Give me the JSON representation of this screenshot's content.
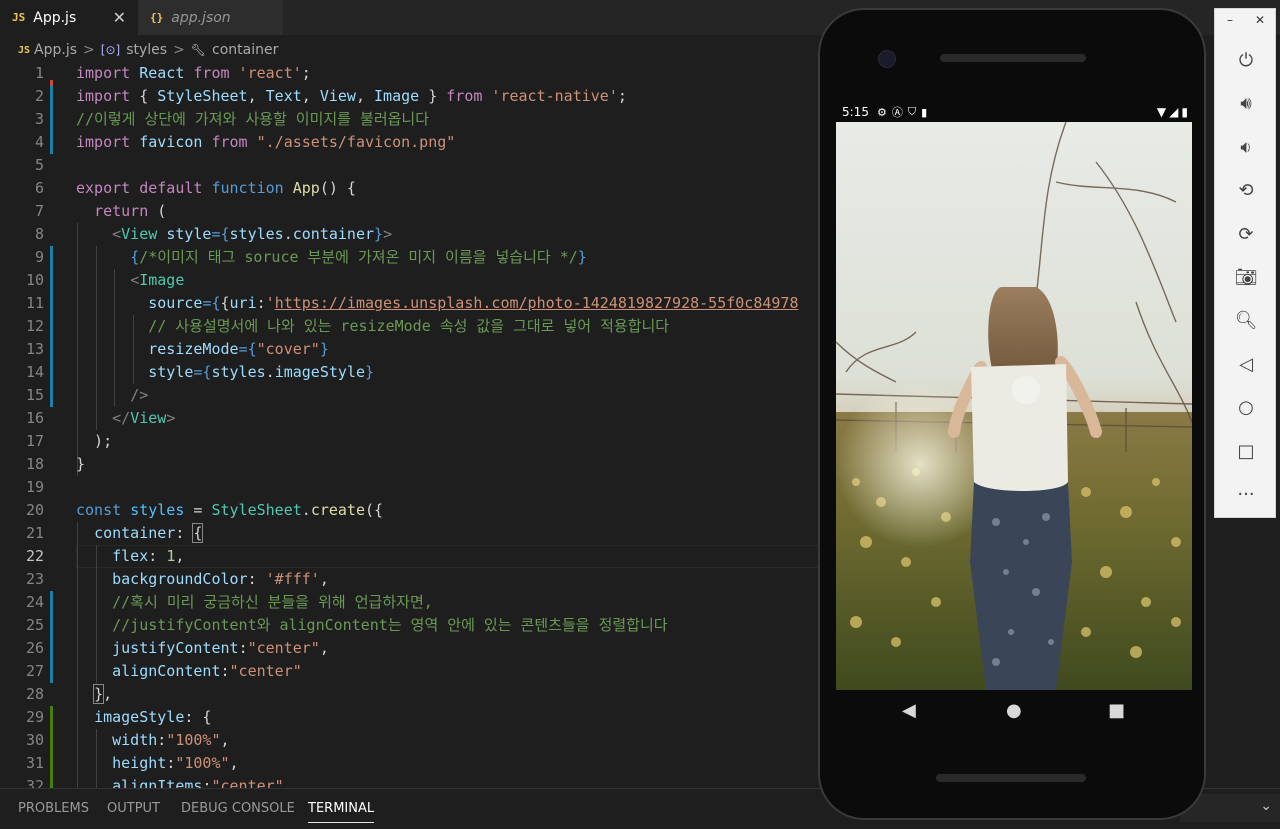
{
  "tabs": [
    {
      "icon": "JS",
      "label": "App.js",
      "close": "✕"
    },
    {
      "icon": "{}",
      "label": "app.json"
    }
  ],
  "breadcrumb": {
    "file_icon": "JS",
    "file": "App.js",
    "sep": ">",
    "b1": "styles",
    "b2": "container"
  },
  "code_lines": [
    [
      {
        "t": "import",
        "c": "#c586c0"
      },
      {
        "t": " React ",
        "c": "#9cdcfe"
      },
      {
        "t": "from",
        "c": "#c586c0"
      },
      {
        "t": " 'react'",
        "c": "#ce9178"
      },
      {
        "t": ";",
        "c": "#d4d4d4"
      }
    ],
    [
      {
        "t": "import",
        "c": "#c586c0"
      },
      {
        "t": " { ",
        "c": "#d4d4d4"
      },
      {
        "t": "StyleSheet",
        "c": "#9cdcfe"
      },
      {
        "t": ", ",
        "c": "#d4d4d4"
      },
      {
        "t": "Text",
        "c": "#9cdcfe"
      },
      {
        "t": ", ",
        "c": "#d4d4d4"
      },
      {
        "t": "View",
        "c": "#9cdcfe"
      },
      {
        "t": ", ",
        "c": "#d4d4d4"
      },
      {
        "t": "Image",
        "c": "#9cdcfe"
      },
      {
        "t": " } ",
        "c": "#d4d4d4"
      },
      {
        "t": "from",
        "c": "#c586c0"
      },
      {
        "t": " 'react-native'",
        "c": "#ce9178"
      },
      {
        "t": ";",
        "c": "#d4d4d4"
      }
    ],
    [
      {
        "t": "//이렇게 상단에 가져와 사용할 이미지를 불러옵니다",
        "c": "#6a9955"
      }
    ],
    [
      {
        "t": "import",
        "c": "#c586c0"
      },
      {
        "t": " favicon ",
        "c": "#9cdcfe"
      },
      {
        "t": "from",
        "c": "#c586c0"
      },
      {
        "t": " \"./assets/favicon.png\"",
        "c": "#ce9178"
      }
    ],
    [],
    [
      {
        "t": "export",
        "c": "#c586c0"
      },
      {
        "t": " ",
        "c": "#d4d4d4"
      },
      {
        "t": "default",
        "c": "#c586c0"
      },
      {
        "t": " ",
        "c": "#d4d4d4"
      },
      {
        "t": "function",
        "c": "#569cd6"
      },
      {
        "t": " ",
        "c": "#d4d4d4"
      },
      {
        "t": "App",
        "c": "#dcdcaa"
      },
      {
        "t": "() {",
        "c": "#d4d4d4"
      }
    ],
    [
      {
        "t": "  ",
        "c": "#d4d4d4"
      },
      {
        "t": "return",
        "c": "#c586c0"
      },
      {
        "t": " (",
        "c": "#d4d4d4"
      }
    ],
    [
      {
        "t": "    ",
        "c": "#d4d4d4"
      },
      {
        "t": "<",
        "c": "#808080"
      },
      {
        "t": "View",
        "c": "#4ec9b0"
      },
      {
        "t": " ",
        "c": "#d4d4d4"
      },
      {
        "t": "style",
        "c": "#9cdcfe"
      },
      {
        "t": "={",
        "c": "#569cd6"
      },
      {
        "t": "styles",
        "c": "#9cdcfe"
      },
      {
        "t": ".",
        "c": "#d4d4d4"
      },
      {
        "t": "container",
        "c": "#9cdcfe"
      },
      {
        "t": "}",
        "c": "#569cd6"
      },
      {
        "t": ">",
        "c": "#808080"
      }
    ],
    [
      {
        "t": "      ",
        "c": "#d4d4d4"
      },
      {
        "t": "{",
        "c": "#569cd6"
      },
      {
        "t": "/*이미지 태그 soruce 부분에 가져온 미지 이름을 넣습니다 */",
        "c": "#6a9955"
      },
      {
        "t": "}",
        "c": "#569cd6"
      }
    ],
    [
      {
        "t": "      ",
        "c": "#d4d4d4"
      },
      {
        "t": "<",
        "c": "#808080"
      },
      {
        "t": "Image",
        "c": "#4ec9b0"
      }
    ],
    [
      {
        "t": "        ",
        "c": "#d4d4d4"
      },
      {
        "t": "source",
        "c": "#9cdcfe"
      },
      {
        "t": "={",
        "c": "#569cd6"
      },
      {
        "t": "{",
        "c": "#d4d4d4"
      },
      {
        "t": "uri",
        "c": "#9cdcfe"
      },
      {
        "t": ":",
        "c": "#d4d4d4"
      },
      {
        "t": "'",
        "c": "#ce9178"
      },
      {
        "t": "https://images.unsplash.com/photo-1424819827928-55f0c84978",
        "c": "#ce9178",
        "u": true
      }
    ],
    [
      {
        "t": "        ",
        "c": "#d4d4d4"
      },
      {
        "t": "// 사용설명서에 나와 있는 resizeMode 속성 값을 그대로 넣어 적용합니다",
        "c": "#6a9955"
      }
    ],
    [
      {
        "t": "        ",
        "c": "#d4d4d4"
      },
      {
        "t": "resizeMode",
        "c": "#9cdcfe"
      },
      {
        "t": "={",
        "c": "#569cd6"
      },
      {
        "t": "\"cover\"",
        "c": "#ce9178"
      },
      {
        "t": "}",
        "c": "#569cd6"
      }
    ],
    [
      {
        "t": "        ",
        "c": "#d4d4d4"
      },
      {
        "t": "style",
        "c": "#9cdcfe"
      },
      {
        "t": "={",
        "c": "#569cd6"
      },
      {
        "t": "styles",
        "c": "#9cdcfe"
      },
      {
        "t": ".",
        "c": "#d4d4d4"
      },
      {
        "t": "imageStyle",
        "c": "#9cdcfe"
      },
      {
        "t": "}",
        "c": "#569cd6"
      }
    ],
    [
      {
        "t": "      ",
        "c": "#d4d4d4"
      },
      {
        "t": "/>",
        "c": "#808080"
      }
    ],
    [
      {
        "t": "    ",
        "c": "#d4d4d4"
      },
      {
        "t": "</",
        "c": "#808080"
      },
      {
        "t": "View",
        "c": "#4ec9b0"
      },
      {
        "t": ">",
        "c": "#808080"
      }
    ],
    [
      {
        "t": "  );",
        "c": "#d4d4d4"
      }
    ],
    [
      {
        "t": "}",
        "c": "#d4d4d4"
      }
    ],
    [],
    [
      {
        "t": "const",
        "c": "#569cd6"
      },
      {
        "t": " ",
        "c": "#d4d4d4"
      },
      {
        "t": "styles",
        "c": "#4fc1ff"
      },
      {
        "t": " = ",
        "c": "#d4d4d4"
      },
      {
        "t": "StyleSheet",
        "c": "#4ec9b0"
      },
      {
        "t": ".",
        "c": "#d4d4d4"
      },
      {
        "t": "create",
        "c": "#dcdcaa"
      },
      {
        "t": "({",
        "c": "#d4d4d4"
      }
    ],
    [
      {
        "t": "  ",
        "c": "#d4d4d4"
      },
      {
        "t": "container",
        "c": "#9cdcfe"
      },
      {
        "t": ": ",
        "c": "#d4d4d4"
      },
      {
        "t": "{",
        "c": "#d4d4d4",
        "b": true
      }
    ],
    [
      {
        "t": "    ",
        "c": "#d4d4d4"
      },
      {
        "t": "flex",
        "c": "#9cdcfe"
      },
      {
        "t": ": ",
        "c": "#d4d4d4"
      },
      {
        "t": "1",
        "c": "#b5cea8"
      },
      {
        "t": ",",
        "c": "#d4d4d4"
      }
    ],
    [
      {
        "t": "    ",
        "c": "#d4d4d4"
      },
      {
        "t": "backgroundColor",
        "c": "#9cdcfe"
      },
      {
        "t": ": ",
        "c": "#d4d4d4"
      },
      {
        "t": "'#fff'",
        "c": "#ce9178"
      },
      {
        "t": ",",
        "c": "#d4d4d4"
      }
    ],
    [
      {
        "t": "    ",
        "c": "#d4d4d4"
      },
      {
        "t": "//혹시 미리 궁금하신 분들을 위해 언급하자면,",
        "c": "#6a9955"
      }
    ],
    [
      {
        "t": "    ",
        "c": "#d4d4d4"
      },
      {
        "t": "//justifyContent와 alignContent는 영역 안에 있는 콘텐츠들을 정렬합니다",
        "c": "#6a9955"
      }
    ],
    [
      {
        "t": "    ",
        "c": "#d4d4d4"
      },
      {
        "t": "justifyContent",
        "c": "#9cdcfe"
      },
      {
        "t": ":",
        "c": "#d4d4d4"
      },
      {
        "t": "\"center\"",
        "c": "#ce9178"
      },
      {
        "t": ",",
        "c": "#d4d4d4"
      }
    ],
    [
      {
        "t": "    ",
        "c": "#d4d4d4"
      },
      {
        "t": "alignContent",
        "c": "#9cdcfe"
      },
      {
        "t": ":",
        "c": "#d4d4d4"
      },
      {
        "t": "\"center\"",
        "c": "#ce9178"
      }
    ],
    [
      {
        "t": "  ",
        "c": "#d4d4d4"
      },
      {
        "t": "}",
        "c": "#d4d4d4",
        "b": true
      },
      {
        "t": ",",
        "c": "#d4d4d4"
      }
    ],
    [
      {
        "t": "  ",
        "c": "#d4d4d4"
      },
      {
        "t": "imageStyle",
        "c": "#9cdcfe"
      },
      {
        "t": ": {",
        "c": "#d4d4d4"
      }
    ],
    [
      {
        "t": "    ",
        "c": "#d4d4d4"
      },
      {
        "t": "width",
        "c": "#9cdcfe"
      },
      {
        "t": ":",
        "c": "#d4d4d4"
      },
      {
        "t": "\"100%\"",
        "c": "#ce9178"
      },
      {
        "t": ",",
        "c": "#d4d4d4"
      }
    ],
    [
      {
        "t": "    ",
        "c": "#d4d4d4"
      },
      {
        "t": "height",
        "c": "#9cdcfe"
      },
      {
        "t": ":",
        "c": "#d4d4d4"
      },
      {
        "t": "\"100%\"",
        "c": "#ce9178"
      },
      {
        "t": ",",
        "c": "#d4d4d4"
      }
    ],
    [
      {
        "t": "    ",
        "c": "#d4d4d4"
      },
      {
        "t": "alignItems",
        "c": "#9cdcfe"
      },
      {
        "t": ":",
        "c": "#d4d4d4"
      },
      {
        "t": "\"center\"",
        "c": "#ce9178"
      }
    ]
  ],
  "gutter_marks": [
    {
      "line": 2,
      "color": "#1b81a8"
    },
    {
      "line": 3,
      "color": "#1b81a8"
    },
    {
      "line": 4,
      "color": "#1b81a8"
    },
    {
      "line": 9,
      "color": "#1b81a8"
    },
    {
      "line": 10,
      "color": "#1b81a8"
    },
    {
      "line": 11,
      "color": "#1b81a8"
    },
    {
      "line": 12,
      "color": "#1b81a8"
    },
    {
      "line": 13,
      "color": "#1b81a8"
    },
    {
      "line": 14,
      "color": "#1b81a8"
    },
    {
      "line": 15,
      "color": "#1b81a8"
    },
    {
      "line": 24,
      "color": "#1b81a8"
    },
    {
      "line": 25,
      "color": "#1b81a8"
    },
    {
      "line": 26,
      "color": "#1b81a8"
    },
    {
      "line": 27,
      "color": "#1b81a8"
    },
    {
      "line": 29,
      "color": "#487e02"
    },
    {
      "line": 30,
      "color": "#487e02"
    },
    {
      "line": 31,
      "color": "#487e02"
    },
    {
      "line": 32,
      "color": "#487e02"
    }
  ],
  "panel_tabs": [
    "PROBLEMS",
    "OUTPUT",
    "DEBUG CONSOLE",
    "TERMINAL"
  ],
  "phone": {
    "status_time": "5:15",
    "status_icons": [
      "settings-icon",
      "a-icon",
      "shield-icon",
      "sd-card-icon"
    ],
    "status_right": [
      "wifi-icon",
      "signal-icon",
      "battery-icon"
    ],
    "nav": [
      "back-icon",
      "home-icon",
      "recents-icon"
    ]
  },
  "emulator_controls": {
    "window": [
      "–",
      "✕"
    ],
    "buttons": [
      "power-icon",
      "volume-up-icon",
      "volume-down-icon",
      "rotate-left-icon",
      "rotate-right-icon",
      "camera-icon",
      "zoom-icon",
      "back-icon",
      "home-icon",
      "overview-icon",
      "more-icon"
    ]
  },
  "colors": {
    "accent": "#007acc",
    "editor_bg": "#1e1e1e"
  }
}
